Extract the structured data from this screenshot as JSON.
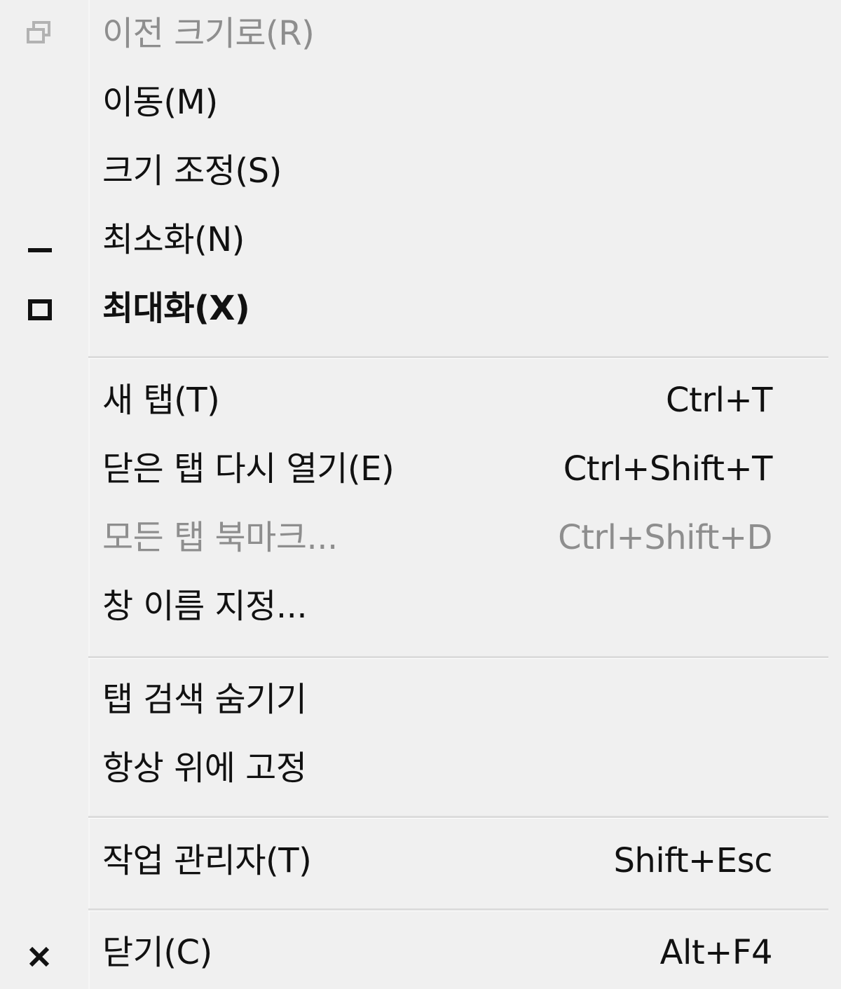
{
  "menu": {
    "items": [
      {
        "label": "이전 크기로(R)",
        "shortcut": "",
        "icon": "restore-icon",
        "state": "disabled"
      },
      {
        "label": "이동(M)",
        "shortcut": "",
        "icon": "",
        "state": "enabled"
      },
      {
        "label": "크기 조정(S)",
        "shortcut": "",
        "icon": "",
        "state": "enabled"
      },
      {
        "label": "최소화(N)",
        "shortcut": "",
        "icon": "minimize-icon",
        "state": "enabled"
      },
      {
        "label": "최대화(X)",
        "shortcut": "",
        "icon": "maximize-icon",
        "state": "enabled-bold"
      },
      {
        "label": "새 탭(T)",
        "shortcut": "Ctrl+T",
        "icon": "",
        "state": "enabled"
      },
      {
        "label": "닫은 탭 다시 열기(E)",
        "shortcut": "Ctrl+Shift+T",
        "icon": "",
        "state": "enabled"
      },
      {
        "label": "모든 탭 북마크...",
        "shortcut": "Ctrl+Shift+D",
        "icon": "",
        "state": "disabled"
      },
      {
        "label": "창 이름 지정...",
        "shortcut": "",
        "icon": "",
        "state": "enabled"
      },
      {
        "label": "탭 검색 숨기기",
        "shortcut": "",
        "icon": "",
        "state": "enabled"
      },
      {
        "label": "항상 위에 고정",
        "shortcut": "",
        "icon": "",
        "state": "enabled"
      },
      {
        "label": "작업 관리자(T)",
        "shortcut": "Shift+Esc",
        "icon": "",
        "state": "enabled"
      },
      {
        "label": "닫기(C)",
        "shortcut": "Alt+F4",
        "icon": "close-icon",
        "state": "enabled"
      }
    ]
  },
  "colors": {
    "background": "#f0f0f0",
    "text": "#111111",
    "disabled_text": "#8e8e8e",
    "separator": "#dcdcdc"
  }
}
